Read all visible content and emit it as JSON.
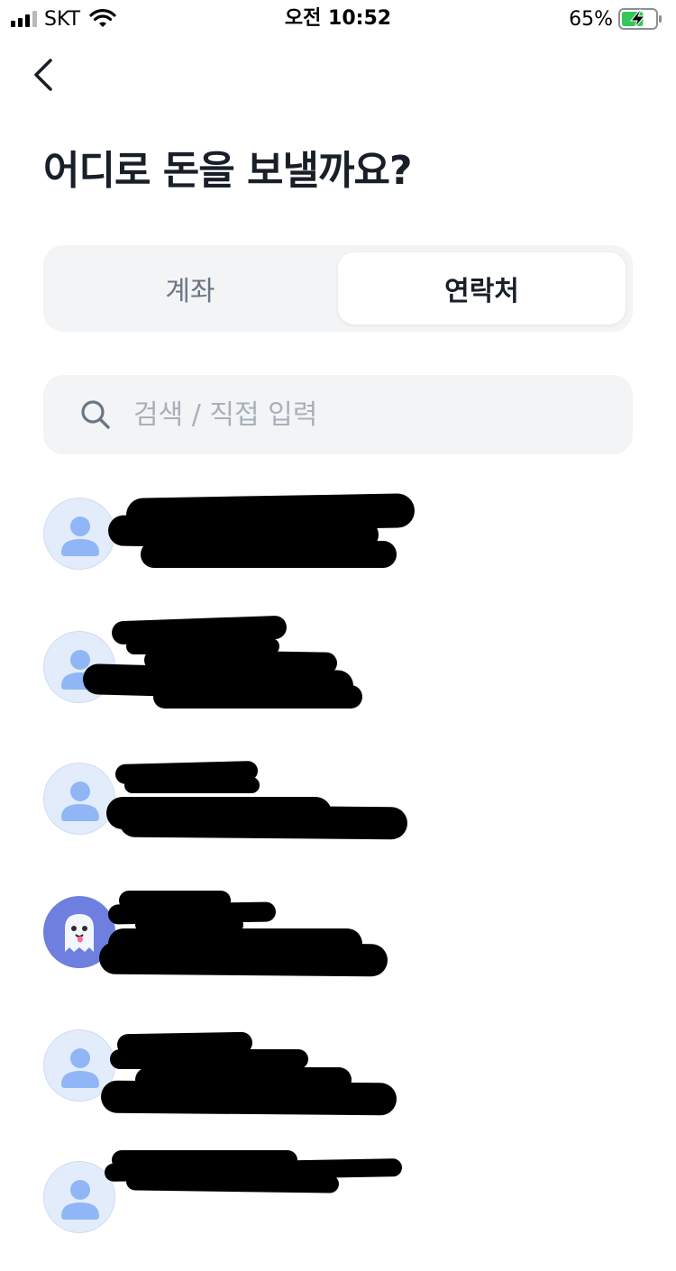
{
  "status_bar": {
    "carrier": "SKT",
    "time": "오전 10:52",
    "battery_percent": "65%",
    "battery_level": 0.65,
    "charging": true
  },
  "nav": {
    "back_icon": "chevron-left-icon"
  },
  "page": {
    "title": "어디로 돈을 보낼까요?"
  },
  "tabs": {
    "items": [
      {
        "label": "계좌",
        "selected": false
      },
      {
        "label": "연락처",
        "selected": true
      }
    ]
  },
  "search": {
    "placeholder": "검색 / 직접 입력",
    "value": "",
    "icon": "search-icon"
  },
  "contacts": [
    {
      "avatar": "default-person-icon",
      "redacted": true
    },
    {
      "avatar": "default-person-icon",
      "redacted": true
    },
    {
      "avatar": "default-person-icon",
      "redacted": true
    },
    {
      "avatar": "ghost-icon",
      "redacted": true
    },
    {
      "avatar": "default-person-icon",
      "redacted": true
    },
    {
      "avatar": "default-person-icon",
      "redacted": true
    }
  ],
  "colors": {
    "title": "#191f28",
    "inactive_tab": "#6b7684",
    "placeholder": "#a8b0b9",
    "surface": "#f2f4f6",
    "avatar_bg": "#e3ecfb",
    "avatar_person": "#90b6f5",
    "ghost_bg": "#6f7fe0",
    "battery_charge": "#35c759"
  }
}
